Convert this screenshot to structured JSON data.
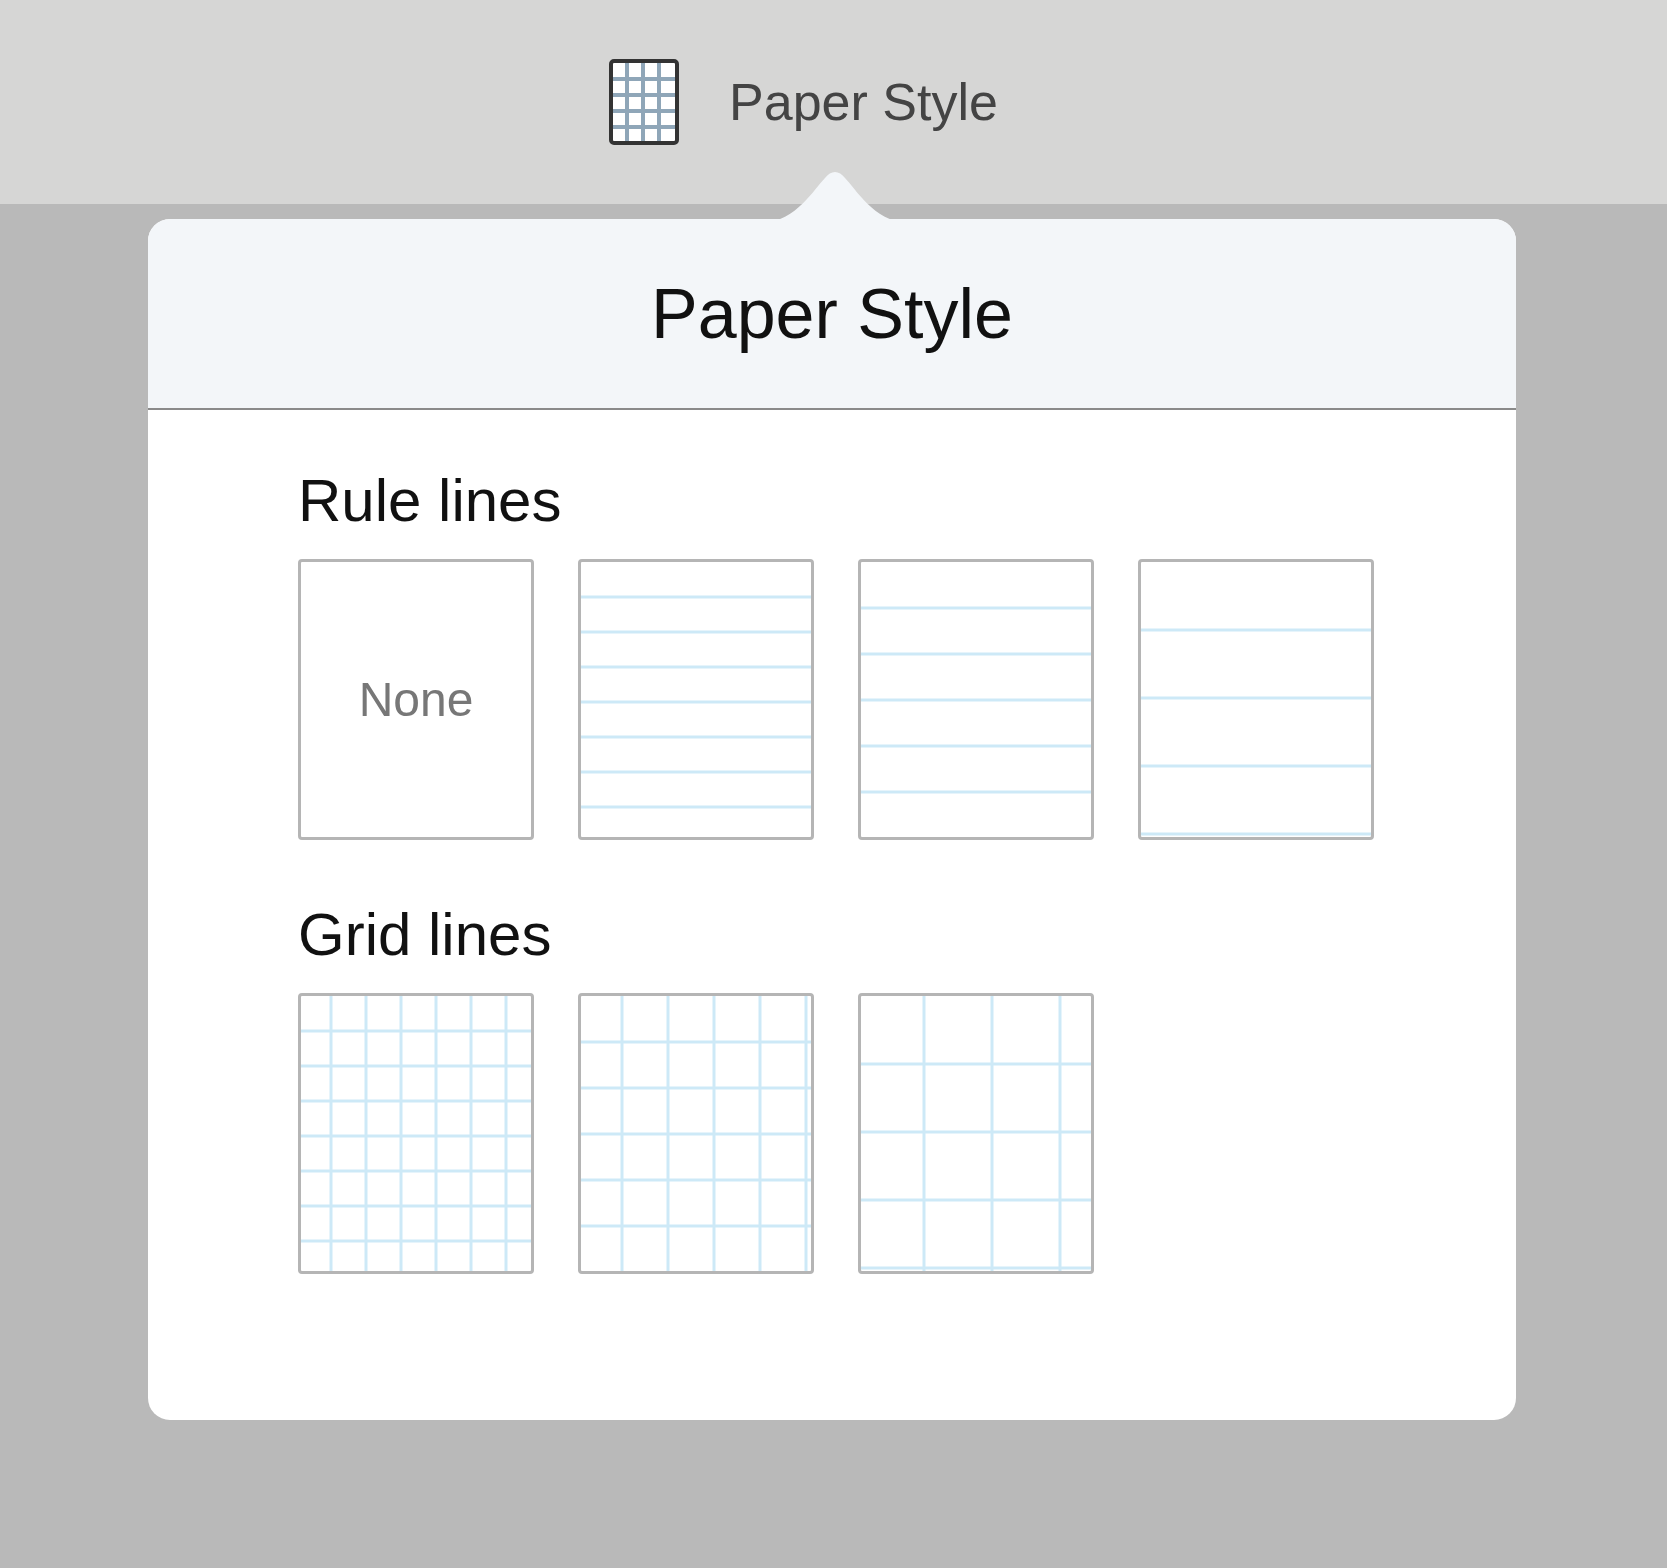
{
  "toolbar": {
    "title": "Paper Style"
  },
  "popover": {
    "title": "Paper Style",
    "sections": [
      {
        "title": "Rule lines",
        "items": [
          {
            "kind": "none",
            "label": "None"
          },
          {
            "kind": "narrowruled"
          },
          {
            "kind": "mediumruled"
          },
          {
            "kind": "wideruled"
          }
        ]
      },
      {
        "title": "Grid lines",
        "items": [
          {
            "kind": "finegrid"
          },
          {
            "kind": "mediumgrid"
          },
          {
            "kind": "coarsegrid"
          }
        ]
      }
    ]
  }
}
